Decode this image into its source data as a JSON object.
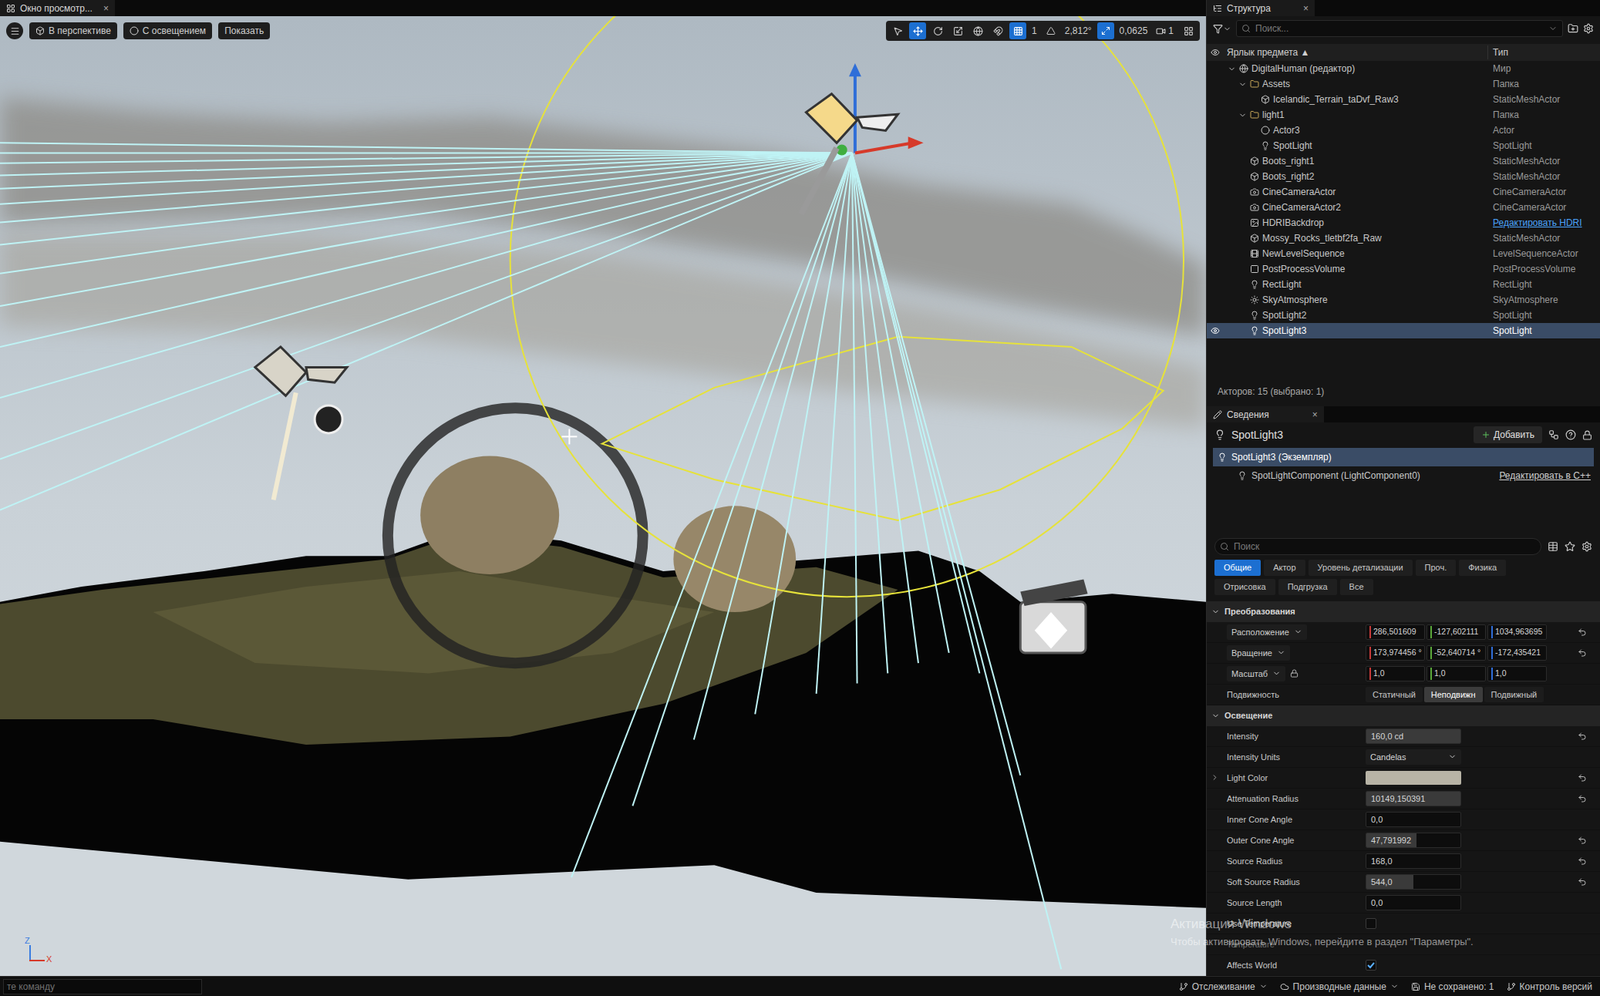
{
  "viewport_tab": {
    "title": "Окно просмотр...",
    "close": "×"
  },
  "viewport_toolbar": {
    "buttons": [
      "В перспективе",
      "С освещением",
      "Показать"
    ],
    "tools": [
      {
        "tool": "select",
        "selected": false
      },
      {
        "tool": "move",
        "selected": true
      },
      {
        "tool": "rotate",
        "selected": false
      },
      {
        "tool": "scale",
        "selected": false
      }
    ],
    "grid_snap": {
      "on": true,
      "value": "1"
    },
    "angle_snap": {
      "on": false,
      "value": "2,812°"
    },
    "scale_snap": {
      "on": true,
      "value": "0,0625"
    },
    "camera_speed": "1"
  },
  "axis": {
    "z": "Z",
    "x": "X"
  },
  "outliner": {
    "tab": "Структура",
    "close": "×",
    "search_placeholder": "Поиск...",
    "columns": [
      "Ярлык предмета ▲",
      "Тип"
    ],
    "rows": [
      {
        "label": "DigitalHuman (редактор)",
        "type": "Мир",
        "depth": 0,
        "kind": "world",
        "has_children": true,
        "expanded": true,
        "selected": false,
        "eye": false,
        "type_link": false
      },
      {
        "label": "Assets",
        "type": "Папка",
        "depth": 1,
        "kind": "folder",
        "has_children": true,
        "expanded": true,
        "selected": false,
        "eye": false,
        "type_link": false
      },
      {
        "label": "Icelandic_Terrain_taDvf_Raw3",
        "type": "StaticMeshActor",
        "depth": 2,
        "kind": "mesh",
        "has_children": false,
        "expanded": false,
        "selected": false,
        "eye": false,
        "type_link": false
      },
      {
        "label": "light1",
        "type": "Папка",
        "depth": 1,
        "kind": "folder",
        "has_children": true,
        "expanded": true,
        "selected": false,
        "eye": false,
        "type_link": false
      },
      {
        "label": "Actor3",
        "type": "Actor",
        "depth": 2,
        "kind": "actor",
        "has_children": false,
        "expanded": false,
        "selected": false,
        "eye": false,
        "type_link": false
      },
      {
        "label": "SpotLight",
        "type": "SpotLight",
        "depth": 2,
        "kind": "spotlight",
        "has_children": false,
        "expanded": false,
        "selected": false,
        "eye": false,
        "type_link": false
      },
      {
        "label": "Boots_right1",
        "type": "StaticMeshActor",
        "depth": 1,
        "kind": "mesh",
        "has_children": false,
        "expanded": false,
        "selected": false,
        "eye": false,
        "type_link": false
      },
      {
        "label": "Boots_right2",
        "type": "StaticMeshActor",
        "depth": 1,
        "kind": "mesh",
        "has_children": false,
        "expanded": false,
        "selected": false,
        "eye": false,
        "type_link": false
      },
      {
        "label": "CineCameraActor",
        "type": "CineCameraActor",
        "depth": 1,
        "kind": "camera",
        "has_children": false,
        "expanded": false,
        "selected": false,
        "eye": false,
        "type_link": false
      },
      {
        "label": "CineCameraActor2",
        "type": "CineCameraActor",
        "depth": 1,
        "kind": "camera",
        "has_children": false,
        "expanded": false,
        "selected": false,
        "eye": false,
        "type_link": false
      },
      {
        "label": "HDRIBackdrop",
        "type": "Редактировать HDRI",
        "depth": 1,
        "kind": "hdri",
        "has_children": false,
        "expanded": false,
        "selected": false,
        "eye": false,
        "type_link": true
      },
      {
        "label": "Mossy_Rocks_tletbf2fa_Raw",
        "type": "StaticMeshActor",
        "depth": 1,
        "kind": "mesh",
        "has_children": false,
        "expanded": false,
        "selected": false,
        "eye": false,
        "type_link": false
      },
      {
        "label": "NewLevelSequence",
        "type": "LevelSequenceActor",
        "depth": 1,
        "kind": "sequence",
        "has_children": false,
        "expanded": false,
        "selected": false,
        "eye": false,
        "type_link": false
      },
      {
        "label": "PostProcessVolume",
        "type": "PostProcessVolume",
        "depth": 1,
        "kind": "postprocess",
        "has_children": false,
        "expanded": false,
        "selected": false,
        "eye": false,
        "type_link": false
      },
      {
        "label": "RectLight",
        "type": "RectLight",
        "depth": 1,
        "kind": "rectlight",
        "has_children": false,
        "expanded": false,
        "selected": false,
        "eye": false,
        "type_link": false
      },
      {
        "label": "SkyAtmosphere",
        "type": "SkyAtmosphere",
        "depth": 1,
        "kind": "sky",
        "has_children": false,
        "expanded": false,
        "selected": false,
        "eye": false,
        "type_link": false
      },
      {
        "label": "SpotLight2",
        "type": "SpotLight",
        "depth": 1,
        "kind": "spotlight",
        "has_children": false,
        "expanded": false,
        "selected": false,
        "eye": false,
        "type_link": false
      },
      {
        "label": "SpotLight3",
        "type": "SpotLight",
        "depth": 1,
        "kind": "spotlight",
        "has_children": false,
        "expanded": false,
        "selected": true,
        "eye": true,
        "type_link": false
      }
    ],
    "count": "Акторов: 15 (выбрано: 1)"
  },
  "details": {
    "tab": "Сведения",
    "close": "×",
    "title": "SpotLight3",
    "add_button": "Добавить",
    "components": [
      {
        "label": "SpotLight3 (Экземпляр)",
        "depth": 0,
        "selected": true,
        "link": ""
      },
      {
        "label": "SpotLightComponent (LightComponent0)",
        "depth": 1,
        "selected": false,
        "link": "Редактировать в C++"
      }
    ],
    "search_placeholder": "Поиск",
    "filter_rows": [
      [
        {
          "label": "Общие",
          "selected": true
        },
        {
          "label": "Актор",
          "selected": false
        },
        {
          "label": "Уровень детализации",
          "selected": false
        },
        {
          "label": "Проч.",
          "selected": false
        },
        {
          "label": "Физика",
          "selected": false
        }
      ],
      [
        {
          "label": "Отрисовка",
          "selected": false
        },
        {
          "label": "Подгрузка",
          "selected": false
        },
        {
          "label": "Все",
          "selected": false
        }
      ]
    ],
    "axis_colors": [
      "#c73a3a",
      "#5aa83a",
      "#2f6ed8"
    ],
    "sections": [
      {
        "title": "Преобразования",
        "expanded": true,
        "rows": [
          {
            "kind": "vector",
            "label": "Расположение",
            "values": [
              "286,501609",
              "-127,602111",
              "1034,963695"
            ],
            "reset": true,
            "lock": false
          },
          {
            "kind": "vector",
            "label": "Вращение",
            "values": [
              "173,974456 °",
              "-52,640714 °",
              "-172,435421"
            ],
            "reset": true,
            "lock": false
          },
          {
            "kind": "vector",
            "label": "Масштаб",
            "values": [
              "1,0",
              "1,0",
              "1,0"
            ],
            "reset": false,
            "lock": true
          },
          {
            "kind": "segmented",
            "label": "Подвижность",
            "options": [
              {
                "label": "Статичный",
                "selected": false
              },
              {
                "label": "Неподвижн",
                "selected": true
              },
              {
                "label": "Подвижный",
                "selected": false
              }
            ],
            "reset": false
          }
        ]
      },
      {
        "title": "Освещение",
        "expanded": true,
        "rows": [
          {
            "kind": "slider",
            "label": "Intensity",
            "value": "160,0 cd",
            "level": 1.0,
            "reset": true,
            "disabled": false
          },
          {
            "kind": "select",
            "label": "Intensity Units",
            "value": "Candelas",
            "reset": false,
            "disabled": false
          },
          {
            "kind": "color",
            "label": "Light Color",
            "color": "#b8b4a6",
            "reset": true,
            "disabled": false
          },
          {
            "kind": "slider",
            "label": "Attenuation Radius",
            "value": "10149,150391",
            "level": 1.0,
            "reset": true,
            "disabled": false
          },
          {
            "kind": "number",
            "label": "Inner Cone Angle",
            "value": "0,0",
            "reset": false,
            "disabled": false
          },
          {
            "kind": "slider",
            "label": "Outer Cone Angle",
            "value": "47,791992",
            "level": 0.53,
            "reset": true,
            "disabled": false
          },
          {
            "kind": "number",
            "label": "Source Radius",
            "value": "168,0",
            "reset": true,
            "disabled": false
          },
          {
            "kind": "slider",
            "label": "Soft Source Radius",
            "value": "544,0",
            "level": 0.5,
            "reset": true,
            "disabled": false
          },
          {
            "kind": "number",
            "label": "Source Length",
            "value": "0,0",
            "reset": false,
            "disabled": false
          },
          {
            "kind": "checkbox",
            "label": "Use Temperature",
            "checked": false,
            "reset": false,
            "disabled": false
          },
          {
            "kind": "label",
            "label": "Temperature",
            "reset": false,
            "disabled": true
          },
          {
            "kind": "checkbox",
            "label": "Affects World",
            "checked": true,
            "reset": false,
            "disabled": false
          }
        ]
      }
    ]
  },
  "status_bar": {
    "console_placeholder": "те команду",
    "items": [
      {
        "label": "Отслеживание",
        "dropdown": true
      },
      {
        "label": "Производные данные",
        "dropdown": true
      },
      {
        "label": "Не сохранено: 1",
        "dropdown": false
      },
      {
        "label": "Контроль версий",
        "dropdown": false
      }
    ]
  },
  "watermark": {
    "title": "Активация Windows",
    "text": "Чтобы активировать Windows, перейдите в раздел \"Параметры\"."
  }
}
